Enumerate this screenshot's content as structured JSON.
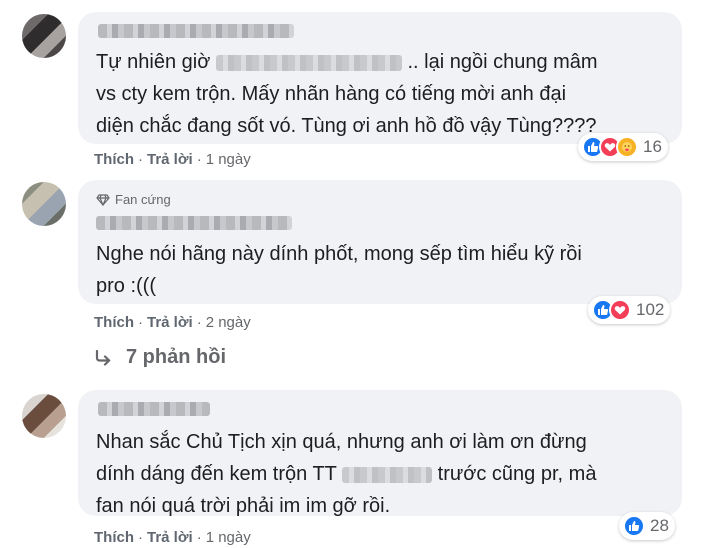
{
  "comments": [
    {
      "line1_a": "Tự nhiên giờ",
      "line1_b": ".. lại ngồi chung mâm",
      "line2": "vs cty kem trộn. Mấy nhãn hàng có tiếng mời anh đại",
      "line3": "diện chắc đang sốt vó. Tùng ơi anh hồ đồ vậy Tùng????",
      "like_label": "Thích",
      "reply_label": "Trả lời",
      "time": "1 ngày",
      "reaction_count": "16",
      "reactions": [
        "like-icon",
        "love-icon",
        "care-icon"
      ]
    },
    {
      "badge": "Fan cứng",
      "line1": "Nghe nói hãng này dính phốt, mong sếp tìm hiểu kỹ rồi",
      "line2": "pro :(((",
      "like_label": "Thích",
      "reply_label": "Trả lời",
      "time": "2 ngày",
      "reaction_count": "102",
      "reactions": [
        "like-icon",
        "love-icon"
      ],
      "replies_label": "7 phản hồi"
    },
    {
      "line1": "Nhan sắc Chủ Tịch xịn quá, nhưng anh ơi làm ơn đừng",
      "line2_a": "dính dáng đến kem trộn TT",
      "line2_b": "trước cũng pr, mà",
      "line3": "fan nói quá trời phải im im gỡ rồi.",
      "like_label": "Thích",
      "reply_label": "Trả lời",
      "time": "1 ngày",
      "reaction_count": "28",
      "reactions": [
        "like-icon"
      ]
    }
  ],
  "colors": {
    "bubble": "#f0f2f5",
    "meta": "#65676b",
    "like": "#1877f2",
    "love": "#f33e58",
    "care": "#f7b125"
  }
}
